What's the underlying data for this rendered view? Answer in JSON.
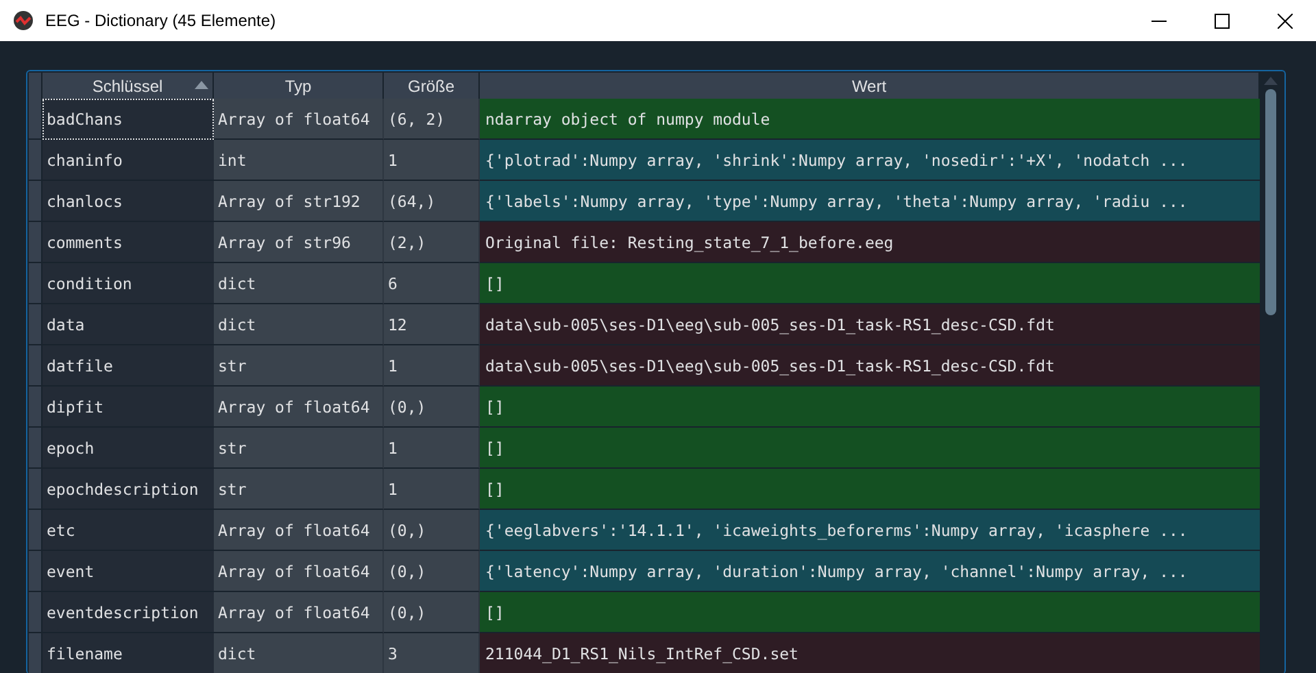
{
  "window": {
    "title": "EEG - Dictionary (45 Elemente)"
  },
  "table": {
    "columns": [
      {
        "label": "Schlüssel",
        "sorted": true
      },
      {
        "label": "Typ",
        "sorted": false
      },
      {
        "label": "Größe",
        "sorted": false
      },
      {
        "label": "Wert",
        "sorted": false
      }
    ],
    "rows": [
      {
        "key": "badChans",
        "type": "Array of float64",
        "size": "(6, 2)",
        "value": "ndarray object of numpy module",
        "color": "#145022",
        "selected": true
      },
      {
        "key": "chaninfo",
        "type": "int",
        "size": "1",
        "value": "{'plotrad':Numpy array, 'shrink':Numpy array, 'nosedir':'+X', 'nodatch ...",
        "color": "#154a55",
        "selected": false
      },
      {
        "key": "chanlocs",
        "type": "Array of str192",
        "size": "(64,)",
        "value": "{'labels':Numpy array, 'type':Numpy array, 'theta':Numpy array, 'radiu ...",
        "color": "#154a55",
        "selected": false
      },
      {
        "key": "comments",
        "type": "Array of str96",
        "size": "(2,)",
        "value": "Original file: Resting_state_7_1_before.eeg",
        "color": "#2e1c24",
        "selected": false
      },
      {
        "key": "condition",
        "type": "dict",
        "size": "6",
        "value": "[]",
        "color": "#145022",
        "selected": false
      },
      {
        "key": "data",
        "type": "dict",
        "size": "12",
        "value": "data\\sub-005\\ses-D1\\eeg\\sub-005_ses-D1_task-RS1_desc-CSD.fdt",
        "color": "#2e1c24",
        "selected": false
      },
      {
        "key": "datfile",
        "type": "str",
        "size": "1",
        "value": "data\\sub-005\\ses-D1\\eeg\\sub-005_ses-D1_task-RS1_desc-CSD.fdt",
        "color": "#2e1c24",
        "selected": false
      },
      {
        "key": "dipfit",
        "type": "Array of float64",
        "size": "(0,)",
        "value": "[]",
        "color": "#145022",
        "selected": false
      },
      {
        "key": "epoch",
        "type": "str",
        "size": "1",
        "value": "[]",
        "color": "#145022",
        "selected": false
      },
      {
        "key": "epochdescription",
        "type": "str",
        "size": "1",
        "value": "[]",
        "color": "#145022",
        "selected": false
      },
      {
        "key": "etc",
        "type": "Array of float64",
        "size": "(0,)",
        "value": "{'eeglabvers':'14.1.1', 'icaweights_beforerms':Numpy array, 'icasphere ...",
        "color": "#154a55",
        "selected": false
      },
      {
        "key": "event",
        "type": "Array of float64",
        "size": "(0,)",
        "value": "{'latency':Numpy array, 'duration':Numpy array, 'channel':Numpy array, ...",
        "color": "#154a55",
        "selected": false
      },
      {
        "key": "eventdescription",
        "type": "Array of float64",
        "size": "(0,)",
        "value": "[]",
        "color": "#145022",
        "selected": false
      },
      {
        "key": "filename",
        "type": "dict",
        "size": "3",
        "value": "211044_D1_RS1_Nils_IntRef_CSD.set",
        "color": "#2e1c24",
        "selected": false
      }
    ]
  }
}
